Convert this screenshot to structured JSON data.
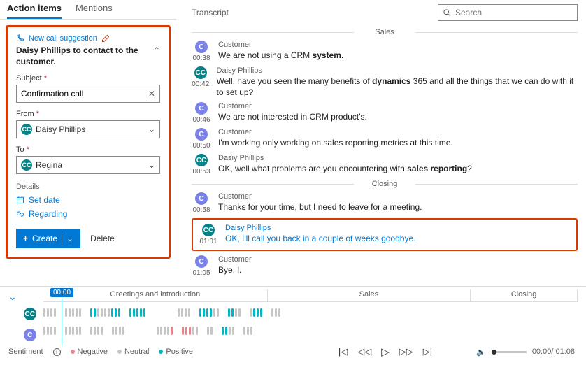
{
  "tabs": {
    "action_items": "Action items",
    "mentions": "Mentions"
  },
  "card": {
    "suggestion_label": "New call suggestion",
    "title": "Daisy Phillips to contact to the customer.",
    "subject_label": "Subject",
    "subject_value": "Confirmation call",
    "from_label": "From",
    "from_value": "Daisy Phillips",
    "to_label": "To",
    "to_value": "Regina",
    "details_label": "Details",
    "set_date": "Set date",
    "regarding": "Regarding",
    "create": "Create",
    "delete": "Delete"
  },
  "transcript": {
    "title": "Transcript",
    "search_placeholder": "Search",
    "sections": {
      "sales": "Sales",
      "closing": "Closing"
    },
    "entries": [
      {
        "avatar": "C",
        "avatarClass": "",
        "time": "00:38",
        "speaker": "Customer",
        "html": "We are not using a CRM <b>system</b>."
      },
      {
        "avatar": "CC",
        "avatarClass": "teal",
        "time": "00:42",
        "speaker": "Daisy Phillips",
        "html": "Well, have you seen the many benefits of <b>dynamics</b> 365 and all the things that we can do with it to set up?"
      },
      {
        "avatar": "C",
        "avatarClass": "",
        "time": "00:46",
        "speaker": "Customer",
        "html": "We are not interested in CRM product's."
      },
      {
        "avatar": "C",
        "avatarClass": "",
        "time": "00:50",
        "speaker": "Customer",
        "html": "I'm working only working on sales reporting metrics at this time."
      },
      {
        "avatar": "CC",
        "avatarClass": "teal",
        "time": "00:53",
        "speaker": "Dasiy Phillips",
        "html": "OK, well what problems are you encountering with <b>sales reporting</b>?"
      }
    ],
    "closing_entries": [
      {
        "avatar": "C",
        "avatarClass": "",
        "time": "00:58",
        "speaker": "Customer",
        "html": "Thanks for your time, but I need to leave for a meeting."
      },
      {
        "avatar": "CC",
        "avatarClass": "teal",
        "time": "01:01",
        "speaker": "Daisy Phillips",
        "html": "OK, <span class='hl-link'>I'll call you back in a couple of weeks goodbye</span>.",
        "highlight": true
      },
      {
        "avatar": "C",
        "avatarClass": "",
        "time": "01:05",
        "speaker": "Customer",
        "html": "Bye, l."
      }
    ]
  },
  "timeline": {
    "marker_time": "00:00",
    "sections": [
      {
        "label": "Greetings and introduction",
        "width": "42%"
      },
      {
        "label": "Sales",
        "width": "38%"
      },
      {
        "label": "Closing",
        "width": "20%"
      }
    ],
    "legend_title": "Sentiment",
    "legend": {
      "negative": "Negative",
      "neutral": "Neutral",
      "positive": "Positive"
    }
  },
  "player": {
    "current": "00:00",
    "total": "01:08"
  }
}
